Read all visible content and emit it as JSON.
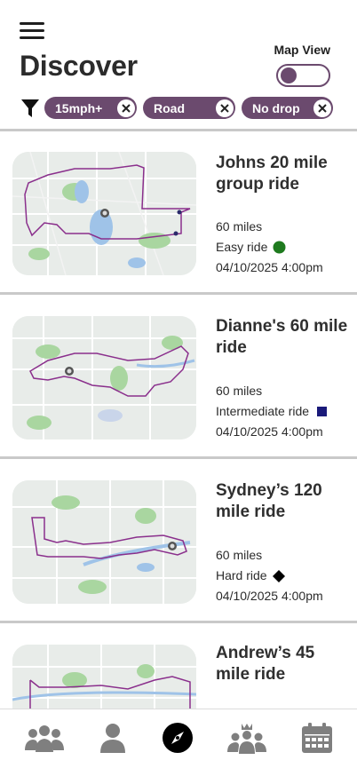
{
  "header": {
    "title": "Discover",
    "map_view_label": "Map View",
    "map_view_on": false
  },
  "filters": [
    {
      "label": "15mph+"
    },
    {
      "label": "Road"
    },
    {
      "label": "No drop"
    }
  ],
  "rides": [
    {
      "title": "Johns 20 mile group ride",
      "distance": "60 miles",
      "level": "Easy ride",
      "level_icon": "green-circle-icon",
      "level_color": "#1e7a1e",
      "datetime": "04/10/2025 4:00pm"
    },
    {
      "title": "Dianne's 60 mile ride",
      "distance": "60 miles",
      "level": "Intermediate ride",
      "level_icon": "blue-square-icon",
      "level_color": "#1a1a7a",
      "datetime": "04/10/2025 4:00pm"
    },
    {
      "title": "Sydney’s 120 mile ride",
      "distance": "60 miles",
      "level": "Hard ride",
      "level_icon": "black-diamond-icon",
      "level_color": "#000000",
      "datetime": "04/10/2025 4:00pm"
    },
    {
      "title": "Andrew’s 45 mile ride"
    }
  ],
  "nav": [
    {
      "icon": "group-icon"
    },
    {
      "icon": "person-icon"
    },
    {
      "icon": "compass-icon",
      "active": true
    },
    {
      "icon": "leader-group-icon"
    },
    {
      "icon": "calendar-icon"
    }
  ],
  "colors": {
    "accent": "#6b4a6e",
    "route": "#8a2f8c",
    "map_bg": "#e6ebe7",
    "map_green": "#a9d6a0",
    "map_water": "#9fc3e8"
  }
}
